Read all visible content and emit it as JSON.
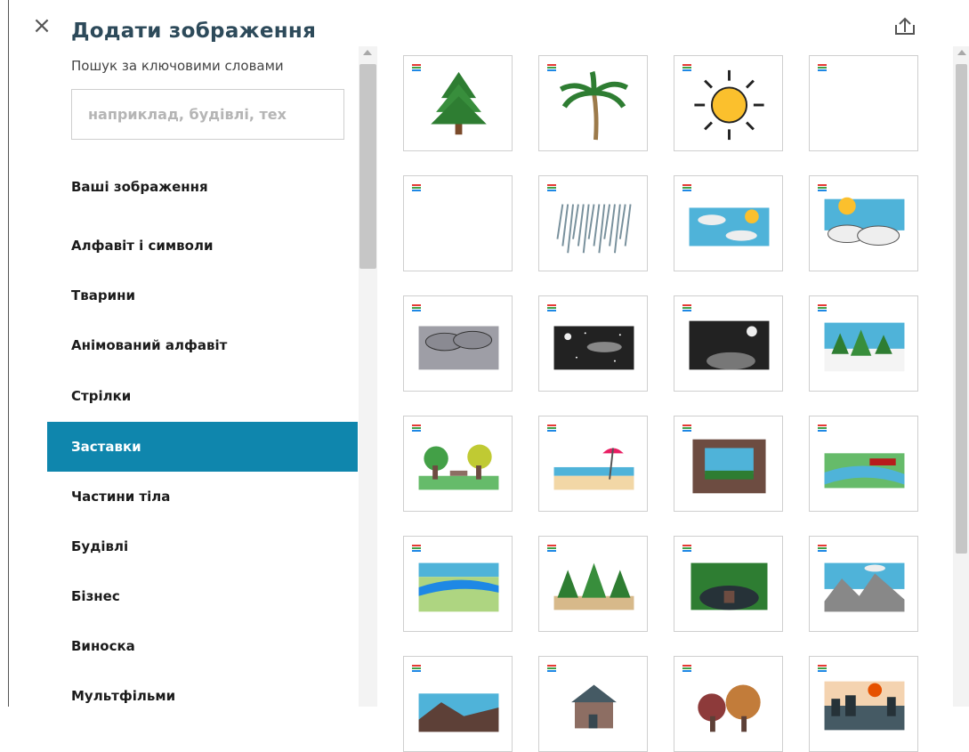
{
  "dialog": {
    "title": "Додати зображення",
    "close_icon": "close-icon",
    "upload_icon": "upload-icon"
  },
  "search": {
    "label": "Пошук за ключовими словами",
    "placeholder": "наприклад, будівлі, тех",
    "value": ""
  },
  "categories": [
    {
      "label": "Ваші зображення",
      "active": false
    },
    {
      "label": "Алфавіт і символи",
      "active": false
    },
    {
      "label": "Тварини",
      "active": false
    },
    {
      "label": "Анімований алфавіт",
      "active": false
    },
    {
      "label": "Стрілки",
      "active": false
    },
    {
      "label": "Заставки",
      "active": true
    },
    {
      "label": "Частини тіла",
      "active": false
    },
    {
      "label": "Будівлі",
      "active": false
    },
    {
      "label": "Бізнес",
      "active": false
    },
    {
      "label": "Виноска",
      "active": false
    },
    {
      "label": "Мультфільми",
      "active": false
    }
  ],
  "colors": {
    "accent": "#0f86ad",
    "title": "#2d4a5a",
    "tile_border": "#cfcfcf"
  },
  "images": [
    {
      "icon": "pine-tree-icon"
    },
    {
      "icon": "palm-tree-icon"
    },
    {
      "icon": "sun-icon"
    },
    {
      "icon": "blank-image-icon"
    },
    {
      "icon": "blank-image-icon"
    },
    {
      "icon": "rain-icon"
    },
    {
      "icon": "clouds-sun-icon"
    },
    {
      "icon": "cloudy-sunrise-icon"
    },
    {
      "icon": "storm-clouds-icon"
    },
    {
      "icon": "night-sky-icon"
    },
    {
      "icon": "night-moon-clouds-icon"
    },
    {
      "icon": "snowy-forest-icon"
    },
    {
      "icon": "park-icon"
    },
    {
      "icon": "beach-icon"
    },
    {
      "icon": "cave-icon"
    },
    {
      "icon": "river-bridge-icon"
    },
    {
      "icon": "river-landscape-icon"
    },
    {
      "icon": "forest-icon"
    },
    {
      "icon": "dark-forest-icon"
    },
    {
      "icon": "mountains-icon"
    },
    {
      "icon": "hills-icon"
    },
    {
      "icon": "house-icon"
    },
    {
      "icon": "autumn-trees-icon"
    },
    {
      "icon": "city-sunset-icon"
    }
  ]
}
